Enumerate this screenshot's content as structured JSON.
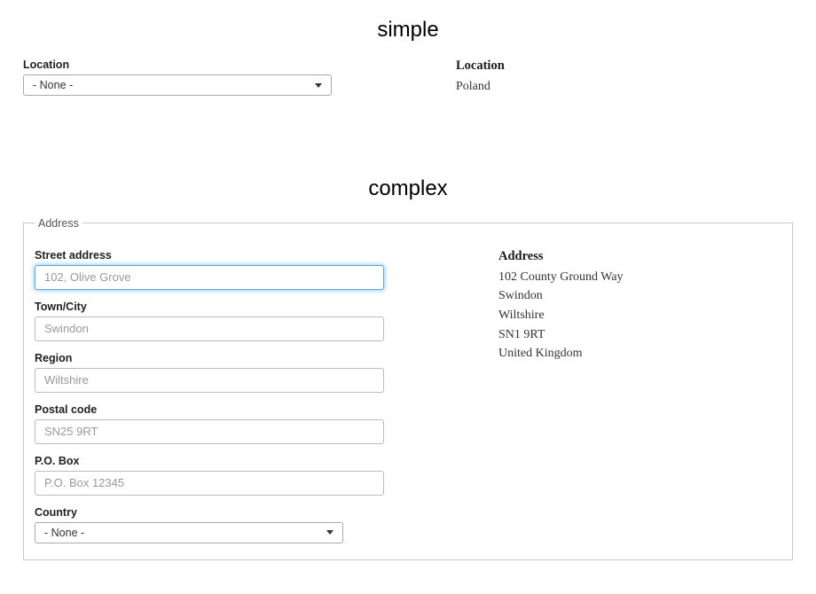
{
  "simple": {
    "heading": "simple",
    "form": {
      "location_label": "Location",
      "location_selected": "- None -"
    },
    "display": {
      "label": "Location",
      "value": "Poland"
    }
  },
  "complex": {
    "heading": "complex",
    "fieldset_legend": "Address",
    "form": {
      "street_label": "Street address",
      "street_placeholder": "102, Olive Grove",
      "town_label": "Town/City",
      "town_placeholder": "Swindon",
      "region_label": "Region",
      "region_placeholder": "Wiltshire",
      "postal_label": "Postal code",
      "postal_placeholder": "SN25 9RT",
      "pobox_label": "P.O. Box",
      "pobox_placeholder": "P.O. Box 12345",
      "country_label": "Country",
      "country_selected": "- None -"
    },
    "display": {
      "label": "Address",
      "lines": {
        "line1": "102 County Ground Way",
        "line2": "Swindon",
        "line3": "Wiltshire",
        "line4": "SN1 9RT",
        "line5": "United Kingdom"
      }
    }
  }
}
